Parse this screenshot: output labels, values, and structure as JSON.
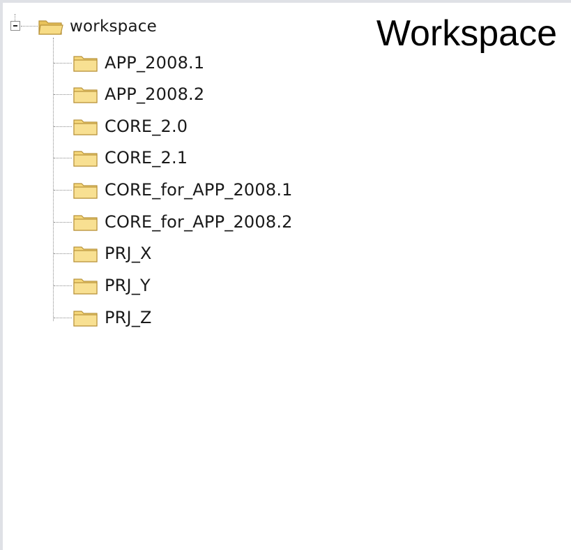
{
  "heading": "Workspace",
  "tree": {
    "root": {
      "label": "workspace",
      "icon": "folder-open-icon",
      "expanded": true
    },
    "children": [
      {
        "label": "APP_2008.1",
        "icon": "folder-icon"
      },
      {
        "label": "APP_2008.2",
        "icon": "folder-icon"
      },
      {
        "label": "CORE_2.0",
        "icon": "folder-icon"
      },
      {
        "label": "CORE_2.1",
        "icon": "folder-icon"
      },
      {
        "label": "CORE_for_APP_2008.1",
        "icon": "folder-icon"
      },
      {
        "label": "CORE_for_APP_2008.2",
        "icon": "folder-icon"
      },
      {
        "label": "PRJ_X",
        "icon": "folder-icon"
      },
      {
        "label": "PRJ_Y",
        "icon": "folder-icon"
      },
      {
        "label": "PRJ_Z",
        "icon": "folder-icon"
      }
    ]
  },
  "colors": {
    "background": "#dfe1e6",
    "panel": "#ffffff",
    "folder_fill": "#f5d77a",
    "folder_edge": "#b8923a"
  }
}
